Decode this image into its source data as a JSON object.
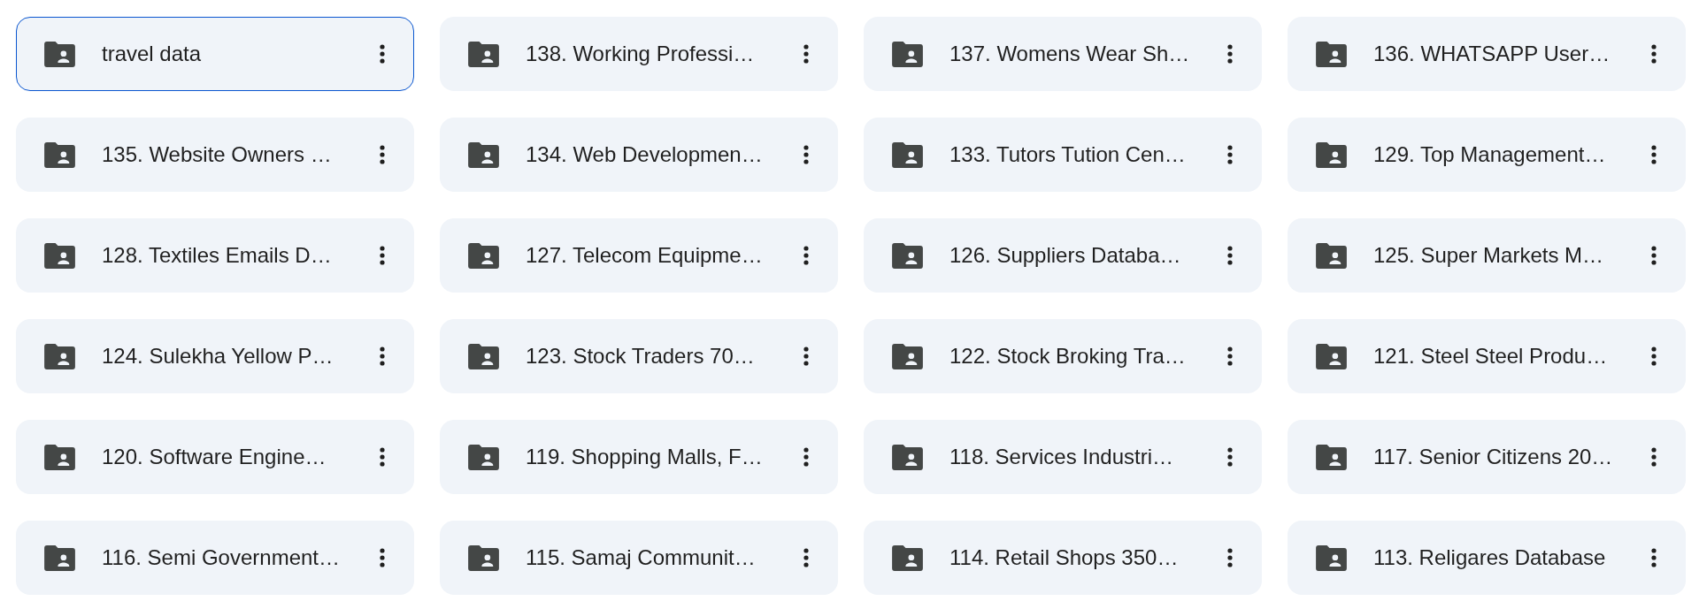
{
  "folders": [
    {
      "name": "travel data",
      "selected": true
    },
    {
      "name": "138. Working Professi…",
      "selected": false
    },
    {
      "name": "137. Womens Wear Sh…",
      "selected": false
    },
    {
      "name": "136. WHATSAPP User…",
      "selected": false
    },
    {
      "name": "135. Website Owners …",
      "selected": false
    },
    {
      "name": "134. Web Developmen…",
      "selected": false
    },
    {
      "name": "133. Tutors Tution Cen…",
      "selected": false
    },
    {
      "name": "129. Top Management…",
      "selected": false
    },
    {
      "name": "128. Textiles Emails D…",
      "selected": false
    },
    {
      "name": "127. Telecom Equipme…",
      "selected": false
    },
    {
      "name": "126. Suppliers Databa…",
      "selected": false
    },
    {
      "name": "125. Super Markets M…",
      "selected": false
    },
    {
      "name": "124. Sulekha Yellow P…",
      "selected": false
    },
    {
      "name": "123. Stock Traders 70…",
      "selected": false
    },
    {
      "name": "122. Stock Broking Tra…",
      "selected": false
    },
    {
      "name": "121. Steel Steel Produ…",
      "selected": false
    },
    {
      "name": "120. Software Engine…",
      "selected": false
    },
    {
      "name": "119. Shopping Malls, F…",
      "selected": false
    },
    {
      "name": "118. Services Industri…",
      "selected": false
    },
    {
      "name": "117. Senior Citizens 20…",
      "selected": false
    },
    {
      "name": "116. Semi Government…",
      "selected": false
    },
    {
      "name": "115. Samaj Communit…",
      "selected": false
    },
    {
      "name": "114. Retail Shops 350…",
      "selected": false
    },
    {
      "name": "113. Religares Database",
      "selected": false
    }
  ]
}
